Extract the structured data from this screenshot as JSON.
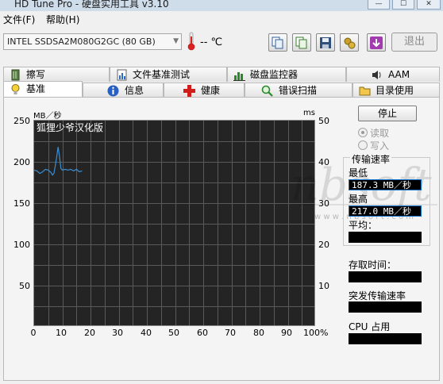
{
  "window": {
    "title": "HD Tune Pro - 硬盘实用工具 v3.10"
  },
  "menu": [
    {
      "label": "文件(F)"
    },
    {
      "label": "帮助(H)"
    }
  ],
  "toolbar": {
    "drive": "INTEL SSDSA2M080G2GC (80 GB)",
    "temperature": "-- ℃",
    "exit_label": "退出",
    "icons": [
      "copy-icon",
      "copy-all-icon",
      "save-icon",
      "options-icon",
      "download-icon"
    ]
  },
  "tabs_top": [
    {
      "label": "擦写",
      "icon": "eraser-icon"
    },
    {
      "label": "文件基准测试",
      "icon": "file-benchmark-icon"
    },
    {
      "label": "磁盘监控器",
      "icon": "disk-monitor-icon"
    },
    {
      "label": "AAM",
      "icon": "speaker-icon"
    }
  ],
  "tabs_bottom": [
    {
      "label": "基准",
      "icon": "benchmark-icon",
      "active": true
    },
    {
      "label": "信息",
      "icon": "info-icon"
    },
    {
      "label": "健康",
      "icon": "health-icon"
    },
    {
      "label": "错误扫描",
      "icon": "error-scan-icon"
    },
    {
      "label": "目录使用",
      "icon": "folder-icon"
    }
  ],
  "chart_data": {
    "type": "line",
    "title": "",
    "annotation": "狐狸少爷汉化版",
    "ylabel_left": "MB／秒",
    "ylabel_right": "ms",
    "ylim_left": [
      0,
      250
    ],
    "ylim_right": [
      0,
      50
    ],
    "yticks_left": [
      "250",
      "200",
      "150",
      "100",
      "50"
    ],
    "yticks_right": [
      "50",
      "40",
      "30",
      "20",
      "10"
    ],
    "xlim": [
      0,
      100
    ],
    "xticks": [
      "0",
      "10",
      "20",
      "30",
      "40",
      "50",
      "60",
      "70",
      "80",
      "90",
      "100%"
    ],
    "grid": true,
    "background": "#242424",
    "series": [
      {
        "color": "#3a8fd6",
        "x": [
          0,
          1,
          2,
          3,
          4,
          5,
          6,
          6.5,
          7,
          7.5,
          8,
          8.5,
          9,
          9.5,
          10,
          11,
          12,
          13,
          14,
          15,
          16,
          17
        ],
        "y": [
          190,
          189,
          186,
          188,
          191,
          190,
          187,
          184,
          186,
          195,
          206,
          218,
          207,
          192,
          190,
          191,
          190,
          191,
          189,
          191,
          188,
          189
        ]
      }
    ]
  },
  "controls": {
    "stop_label": "停止",
    "radio_read": "读取",
    "radio_write": "写入",
    "transfer_rate_title": "传输速率",
    "min_label": "最低",
    "min_value": "187.3 MB／秒",
    "max_label": "最高",
    "max_value": "217.0 MB／秒",
    "avg_label": "平均：",
    "access_time_label": "存取时间：",
    "burst_rate_label": "突发传输速率",
    "cpu_label": "CPU 占用"
  },
  "watermark": {
    "url_text": "w w w . n b s o f t . c o m",
    "script_text": "nbsoft"
  }
}
